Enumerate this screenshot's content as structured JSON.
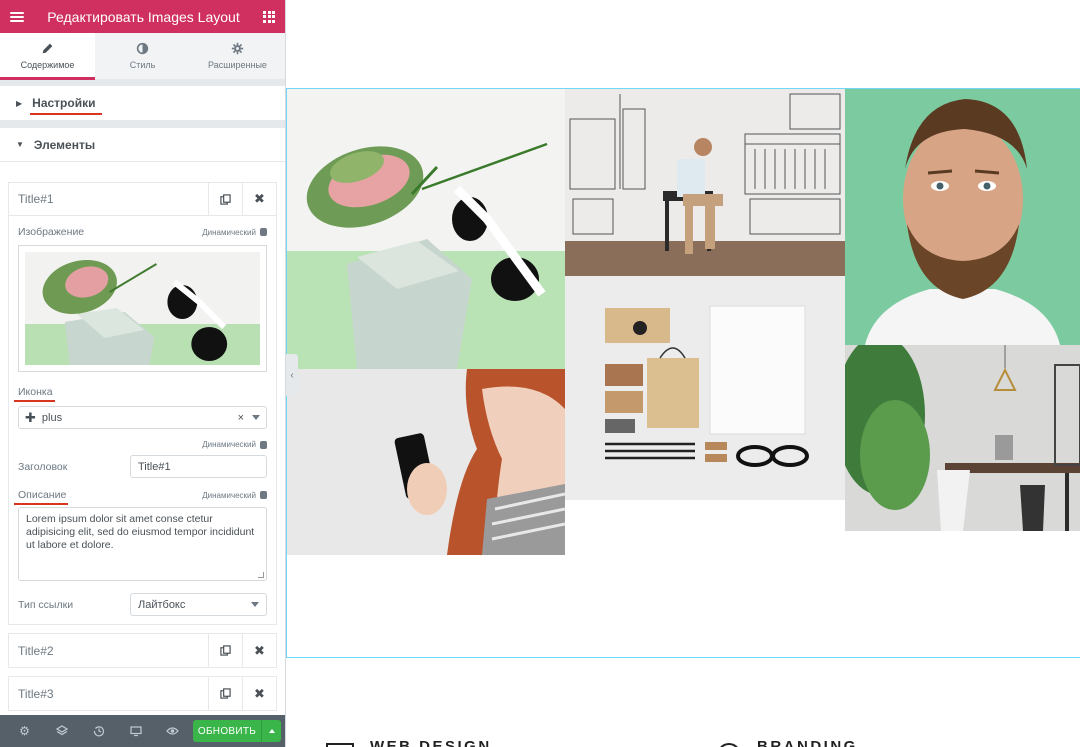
{
  "panel": {
    "title": "Редактировать Images Layout",
    "tabs": [
      {
        "label": "Содержимое",
        "icon": "pencil-icon",
        "active": true
      },
      {
        "label": "Стиль",
        "icon": "contrast-icon",
        "active": false
      },
      {
        "label": "Расширенные",
        "icon": "gear-icon",
        "active": false
      }
    ],
    "sections": {
      "settings": "Настройки",
      "elements": "Элементы"
    },
    "items": [
      {
        "title": "Title#1",
        "expanded": true
      },
      {
        "title": "Title#2",
        "expanded": false
      },
      {
        "title": "Title#3",
        "expanded": false
      }
    ],
    "item1": {
      "image_label": "Изображение",
      "dynamic_label": "Динамический",
      "icon_label": "Иконка",
      "icon_value": "plus",
      "icon_clear": "×",
      "heading_label": "Заголовок",
      "heading_value": "Title#1",
      "description_label": "Описание",
      "description_value": "Lorem ipsum dolor sit amet conse ctetur adipisicing elit, sed do eiusmod tempor incididunt ut labore et dolore.",
      "link_type_label": "Тип ссылки",
      "link_type_value": "Лайтбокс"
    },
    "footer": {
      "update_label": "ОБНОВИТЬ",
      "icons": [
        "settings-icon",
        "layers-icon",
        "history-icon",
        "responsive-icon",
        "preview-icon"
      ]
    }
  },
  "canvas": {
    "services": [
      {
        "label": "WEB DESIGN"
      },
      {
        "label": "BRANDING"
      }
    ]
  },
  "colors": {
    "header_bg": "#d0305f",
    "accent_red": "#d9341d",
    "update_green": "#39b54a",
    "footer_bg": "#556068",
    "section_outline": "#71d7f7",
    "mint": "#7ccba0"
  }
}
